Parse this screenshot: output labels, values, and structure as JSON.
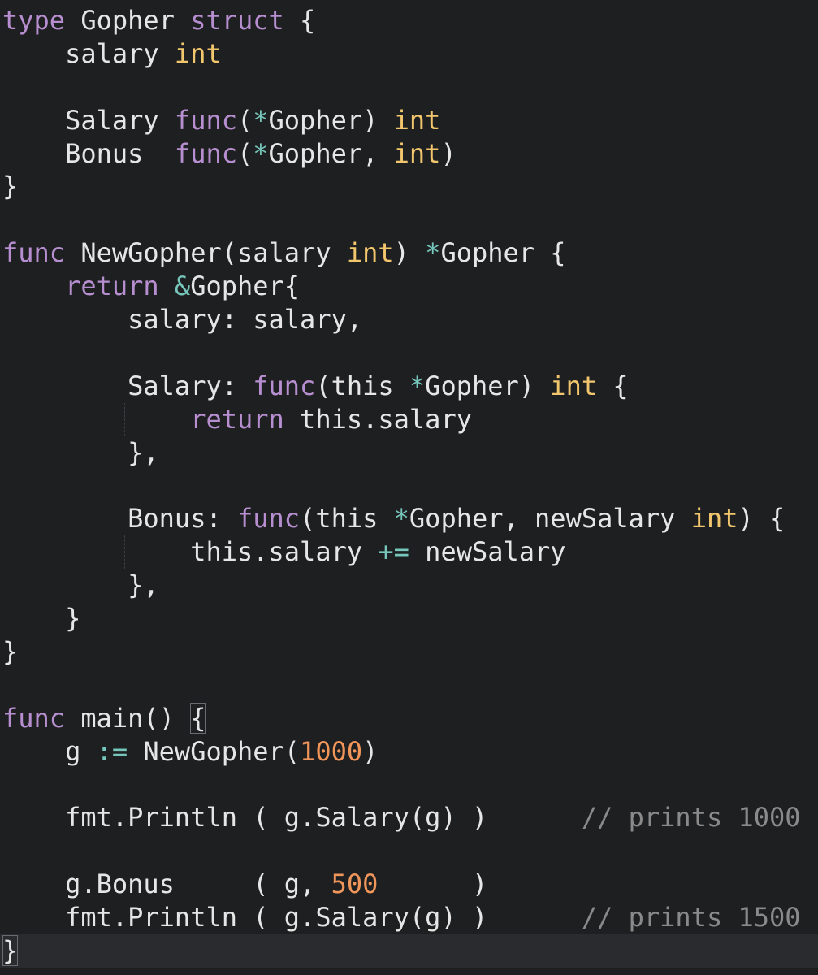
{
  "colors": {
    "background": "#1e1f21",
    "current_line": "#2a2b2e",
    "text": "#e6e6e6",
    "keyword": "#b78fd0",
    "type": "#f2c66d",
    "operator": "#76c6bb",
    "number": "#f0965a",
    "comment": "#8a8a8a"
  },
  "editor": {
    "language": "go",
    "current_line_index": 28,
    "lines": [
      [
        {
          "t": "kw",
          "v": "type"
        },
        {
          "t": "tx",
          "v": " Gopher "
        },
        {
          "t": "kw",
          "v": "struct"
        },
        {
          "t": "tx",
          "v": " {"
        }
      ],
      [
        {
          "t": "tx",
          "v": "    salary "
        },
        {
          "t": "ty",
          "v": "int"
        }
      ],
      [],
      [
        {
          "t": "tx",
          "v": "    Salary "
        },
        {
          "t": "kw",
          "v": "func"
        },
        {
          "t": "tx",
          "v": "("
        },
        {
          "t": "op",
          "v": "*"
        },
        {
          "t": "tx",
          "v": "Gopher) "
        },
        {
          "t": "ty",
          "v": "int"
        }
      ],
      [
        {
          "t": "tx",
          "v": "    Bonus  "
        },
        {
          "t": "kw",
          "v": "func"
        },
        {
          "t": "tx",
          "v": "("
        },
        {
          "t": "op",
          "v": "*"
        },
        {
          "t": "tx",
          "v": "Gopher, "
        },
        {
          "t": "ty",
          "v": "int"
        },
        {
          "t": "tx",
          "v": ")"
        }
      ],
      [
        {
          "t": "tx",
          "v": "}"
        }
      ],
      [],
      [
        {
          "t": "kw",
          "v": "func"
        },
        {
          "t": "tx",
          "v": " NewGopher(salary "
        },
        {
          "t": "ty",
          "v": "int"
        },
        {
          "t": "tx",
          "v": ") "
        },
        {
          "t": "op",
          "v": "*"
        },
        {
          "t": "tx",
          "v": "Gopher {"
        }
      ],
      [
        {
          "t": "tx",
          "v": "    "
        },
        {
          "t": "kw",
          "v": "return"
        },
        {
          "t": "tx",
          "v": " "
        },
        {
          "t": "op",
          "v": "&"
        },
        {
          "t": "tx",
          "v": "Gopher{"
        }
      ],
      [
        {
          "t": "tx",
          "v": "        salary: salary,"
        }
      ],
      [],
      [
        {
          "t": "tx",
          "v": "        Salary: "
        },
        {
          "t": "kw",
          "v": "func"
        },
        {
          "t": "tx",
          "v": "(this "
        },
        {
          "t": "op",
          "v": "*"
        },
        {
          "t": "tx",
          "v": "Gopher) "
        },
        {
          "t": "ty",
          "v": "int"
        },
        {
          "t": "tx",
          "v": " {"
        }
      ],
      [
        {
          "t": "tx",
          "v": "            "
        },
        {
          "t": "kw",
          "v": "return"
        },
        {
          "t": "tx",
          "v": " this.salary"
        }
      ],
      [
        {
          "t": "tx",
          "v": "        },"
        }
      ],
      [],
      [
        {
          "t": "tx",
          "v": "        Bonus: "
        },
        {
          "t": "kw",
          "v": "func"
        },
        {
          "t": "tx",
          "v": "(this "
        },
        {
          "t": "op",
          "v": "*"
        },
        {
          "t": "tx",
          "v": "Gopher, newSalary "
        },
        {
          "t": "ty",
          "v": "int"
        },
        {
          "t": "tx",
          "v": ") {"
        }
      ],
      [
        {
          "t": "tx",
          "v": "            this.salary "
        },
        {
          "t": "op",
          "v": "+="
        },
        {
          "t": "tx",
          "v": " newSalary"
        }
      ],
      [
        {
          "t": "tx",
          "v": "        },"
        }
      ],
      [
        {
          "t": "tx",
          "v": "    }"
        }
      ],
      [
        {
          "t": "tx",
          "v": "}"
        }
      ],
      [],
      [
        {
          "t": "kw",
          "v": "func"
        },
        {
          "t": "tx",
          "v": " main() "
        },
        {
          "t": "box",
          "v": "{"
        }
      ],
      [
        {
          "t": "tx",
          "v": "    g "
        },
        {
          "t": "op",
          "v": ":="
        },
        {
          "t": "tx",
          "v": " NewGopher("
        },
        {
          "t": "num",
          "v": "1000"
        },
        {
          "t": "tx",
          "v": ")"
        }
      ],
      [],
      [
        {
          "t": "tx",
          "v": "    fmt.Println ( g.Salary(g) )      "
        },
        {
          "t": "cm",
          "v": "// prints 1000"
        }
      ],
      [],
      [
        {
          "t": "tx",
          "v": "    g.Bonus     ( g, "
        },
        {
          "t": "num",
          "v": "500"
        },
        {
          "t": "tx",
          "v": "      )"
        }
      ],
      [
        {
          "t": "tx",
          "v": "    fmt.Println ( g.Salary(g) )      "
        },
        {
          "t": "cm",
          "v": "// prints 1500"
        }
      ],
      [
        {
          "t": "box",
          "v": "}"
        }
      ]
    ]
  }
}
